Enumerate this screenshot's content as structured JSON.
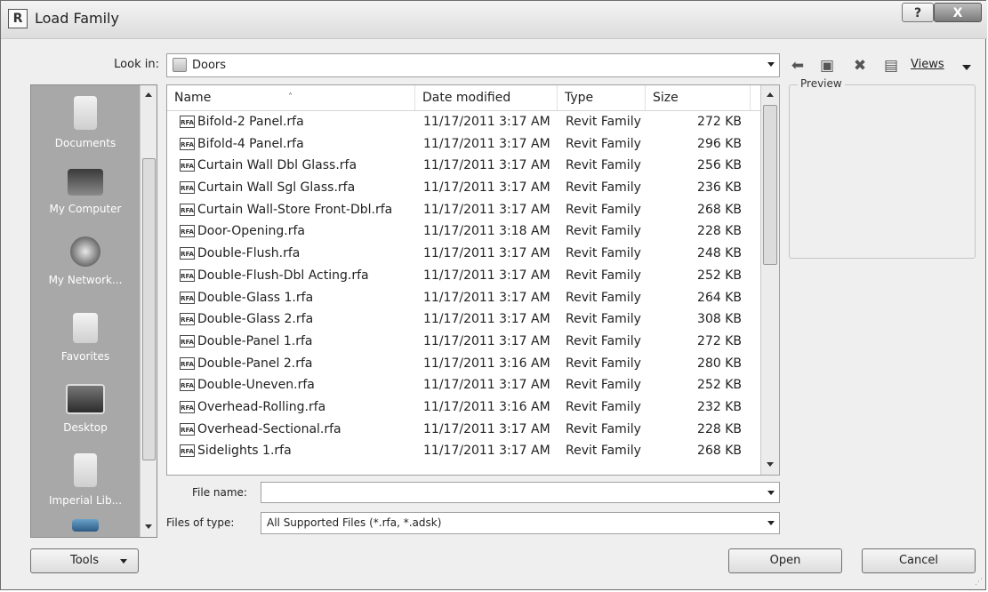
{
  "window": {
    "title": "Load Family",
    "app_icon": "R",
    "help_label": "?",
    "close_label": "X"
  },
  "lookin": {
    "label": "Look in:",
    "value": "Doors"
  },
  "toolbar": {
    "views_label": "Views"
  },
  "places": [
    {
      "label": "Documents",
      "icon": "documents-icon"
    },
    {
      "label": "My Computer",
      "icon": "computer-icon"
    },
    {
      "label": "My Network...",
      "icon": "network-icon"
    },
    {
      "label": "Favorites",
      "icon": "favorites-icon"
    },
    {
      "label": "Desktop",
      "icon": "desktop-icon"
    },
    {
      "label": "Imperial Lib...",
      "icon": "folder-icon"
    }
  ],
  "columns": {
    "name": "Name",
    "date": "Date modified",
    "type": "Type",
    "size": "Size"
  },
  "files": [
    {
      "name": "Bifold-2 Panel.rfa",
      "date": "11/17/2011 3:17 AM",
      "type": "Revit Family",
      "size": "272 KB"
    },
    {
      "name": "Bifold-4 Panel.rfa",
      "date": "11/17/2011 3:17 AM",
      "type": "Revit Family",
      "size": "296 KB"
    },
    {
      "name": "Curtain Wall Dbl Glass.rfa",
      "date": "11/17/2011 3:17 AM",
      "type": "Revit Family",
      "size": "256 KB"
    },
    {
      "name": "Curtain Wall Sgl Glass.rfa",
      "date": "11/17/2011 3:17 AM",
      "type": "Revit Family",
      "size": "236 KB"
    },
    {
      "name": "Curtain Wall-Store Front-Dbl.rfa",
      "date": "11/17/2011 3:17 AM",
      "type": "Revit Family",
      "size": "268 KB"
    },
    {
      "name": "Door-Opening.rfa",
      "date": "11/17/2011 3:18 AM",
      "type": "Revit Family",
      "size": "228 KB"
    },
    {
      "name": "Double-Flush.rfa",
      "date": "11/17/2011 3:17 AM",
      "type": "Revit Family",
      "size": "248 KB"
    },
    {
      "name": "Double-Flush-Dbl Acting.rfa",
      "date": "11/17/2011 3:17 AM",
      "type": "Revit Family",
      "size": "252 KB"
    },
    {
      "name": "Double-Glass 1.rfa",
      "date": "11/17/2011 3:17 AM",
      "type": "Revit Family",
      "size": "264 KB"
    },
    {
      "name": "Double-Glass 2.rfa",
      "date": "11/17/2011 3:17 AM",
      "type": "Revit Family",
      "size": "308 KB"
    },
    {
      "name": "Double-Panel 1.rfa",
      "date": "11/17/2011 3:17 AM",
      "type": "Revit Family",
      "size": "272 KB"
    },
    {
      "name": "Double-Panel 2.rfa",
      "date": "11/17/2011 3:16 AM",
      "type": "Revit Family",
      "size": "280 KB"
    },
    {
      "name": "Double-Uneven.rfa",
      "date": "11/17/2011 3:17 AM",
      "type": "Revit Family",
      "size": "252 KB"
    },
    {
      "name": "Overhead-Rolling.rfa",
      "date": "11/17/2011 3:16 AM",
      "type": "Revit Family",
      "size": "232 KB"
    },
    {
      "name": "Overhead-Sectional.rfa",
      "date": "11/17/2011 3:17 AM",
      "type": "Revit Family",
      "size": "228 KB"
    },
    {
      "name": "Sidelights 1.rfa",
      "date": "11/17/2011 3:17 AM",
      "type": "Revit Family",
      "size": "268 KB"
    }
  ],
  "file_icon_text": "RFA",
  "preview": {
    "label": "Preview"
  },
  "filename": {
    "label": "File name:",
    "value": ""
  },
  "filetype": {
    "label": "Files of type:",
    "value": "All Supported Files  (*.rfa, *.adsk)"
  },
  "buttons": {
    "tools": "Tools",
    "open": "Open",
    "cancel": "Cancel"
  }
}
